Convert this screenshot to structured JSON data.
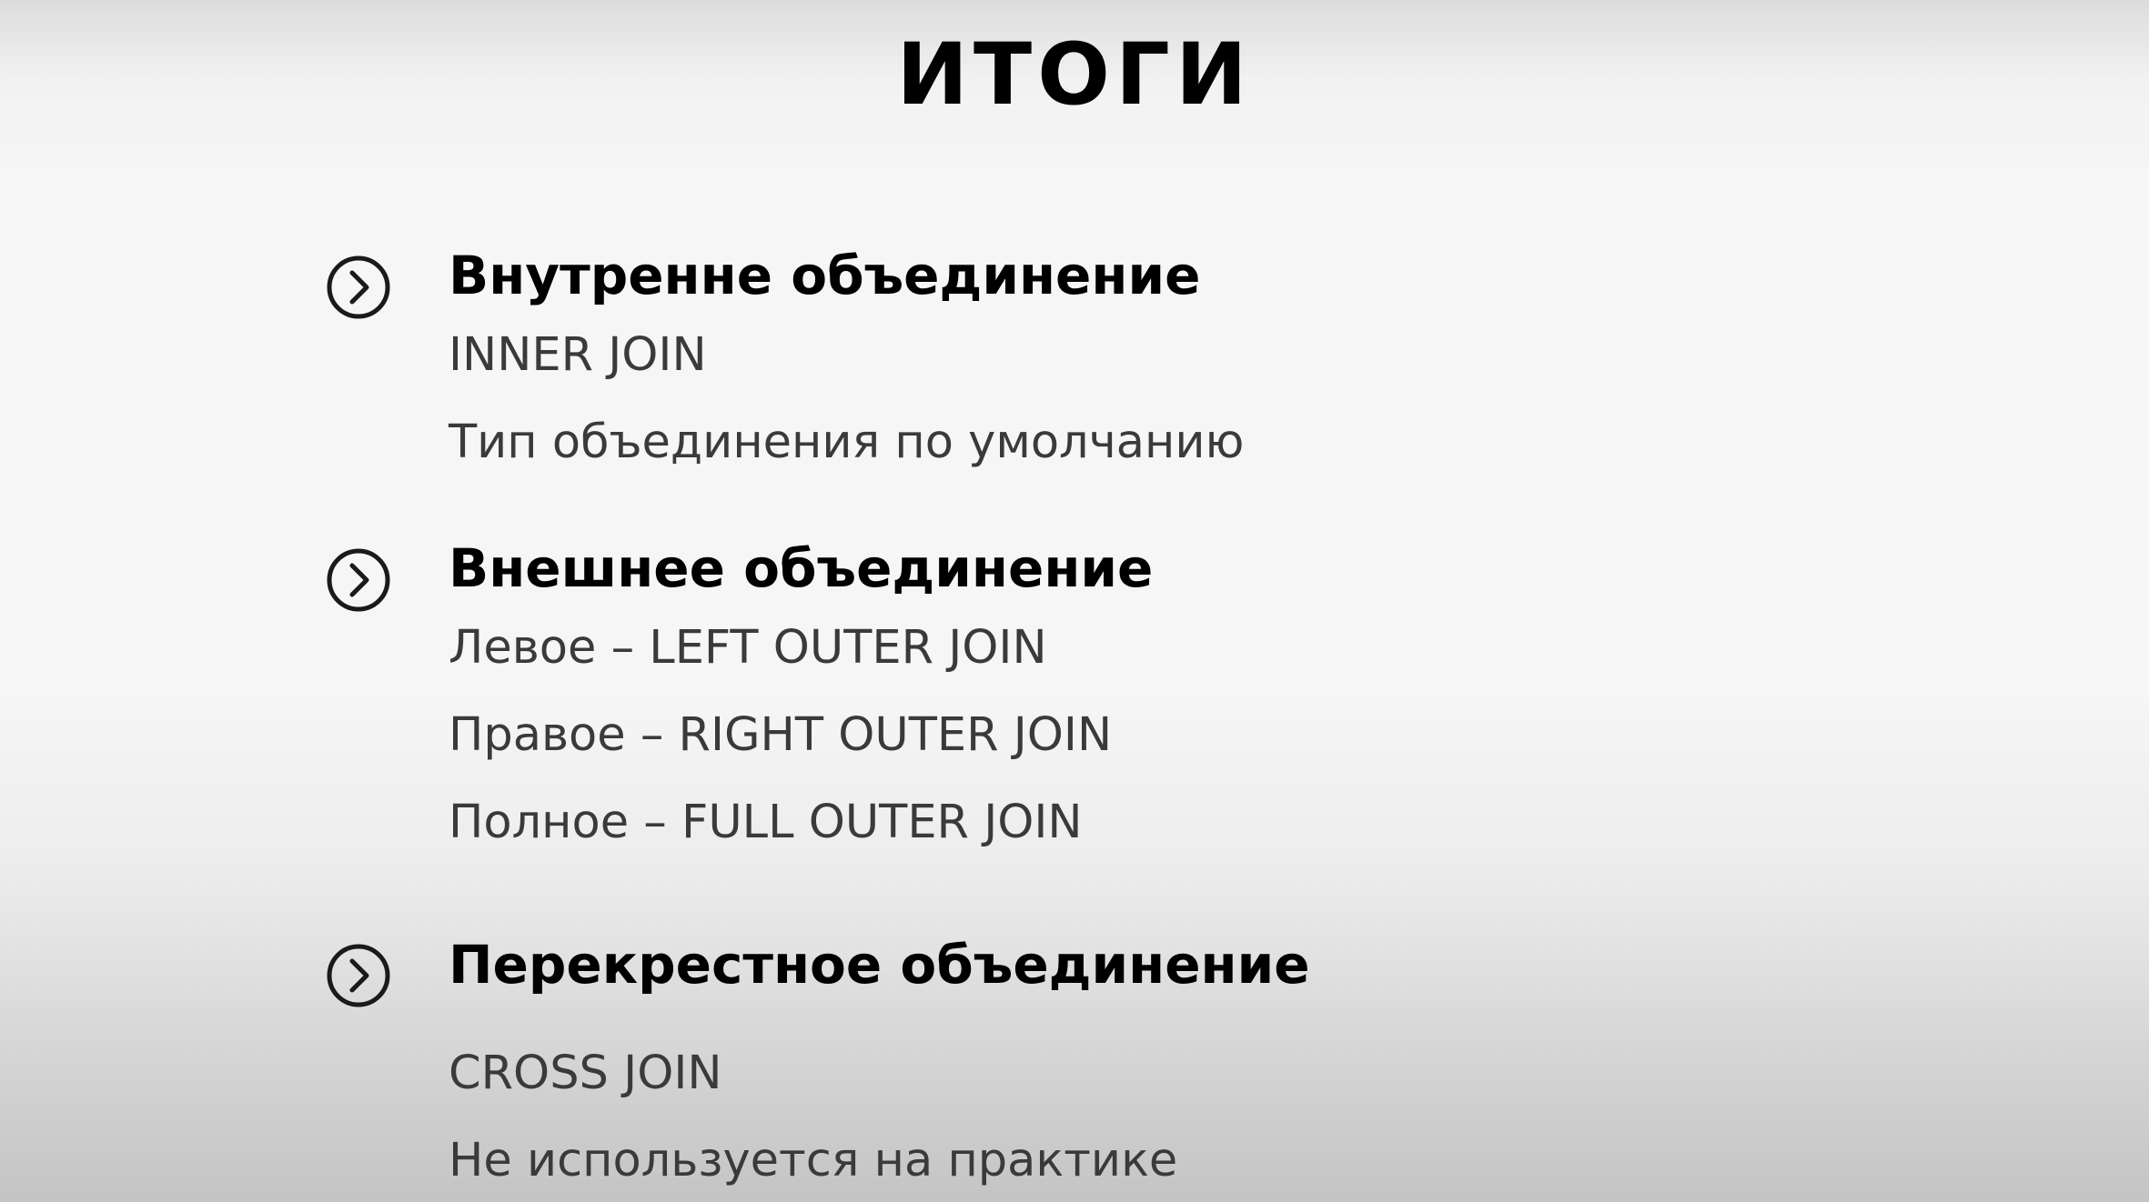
{
  "title": "ИТОГИ",
  "sections": [
    {
      "icon": "chevron-right-circle-icon",
      "heading": "Внутренне объединение",
      "lines": [
        "INNER JOIN",
        "Тип объединения по умолчанию"
      ]
    },
    {
      "icon": "chevron-right-circle-icon",
      "heading": "Внешнее объединение",
      "lines": [
        "Левое – LEFT OUTER JOIN",
        "Правое – RIGHT OUTER JOIN",
        "Полное – FULL OUTER JOIN"
      ]
    },
    {
      "icon": "chevron-right-circle-icon",
      "heading": "Перекрестное объединение",
      "lines": [
        "CROSS JOIN",
        "Не используется на практике"
      ]
    }
  ]
}
